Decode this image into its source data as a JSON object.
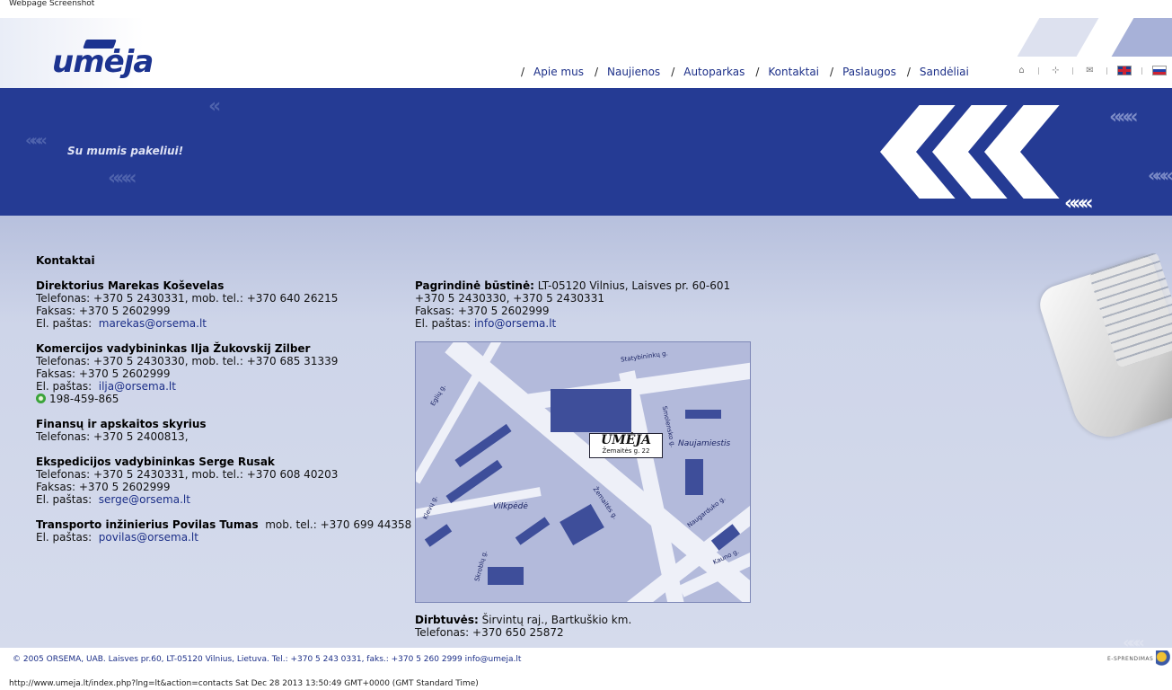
{
  "caption": "Webpage Screenshot",
  "logo": "umėja",
  "nav": [
    "Apie mus",
    "Naujienos",
    "Autoparkas",
    "Kontaktai",
    "Paslaugos",
    "Sandėliai"
  ],
  "tools": [
    "home-icon",
    "sitemap-icon",
    "mail-icon",
    "flag-gb-icon",
    "flag-ru-icon"
  ],
  "banner": {
    "slogan": "Su mumis pakeliui!"
  },
  "contacts": {
    "heading": "Kontaktai",
    "persons": [
      {
        "title": "Direktorius  Marekas Koševelas",
        "phone": "Telefonas:  +370 5 2430331,  mob. tel.:  +370 640 26215",
        "fax": "Faksas: +370 5 2602999",
        "email_label": "El. paštas:",
        "email": "marekas@orsema.lt"
      },
      {
        "title": "Komercijos vadybininkas  Ilja Žukovskij Zilber",
        "phone": "Telefonas:  +370 5 2430330,  mob. tel.:  +370 685 31339",
        "fax": "Faksas: +370 5 2602999",
        "email_label": "El. paštas:",
        "email": "ilja@orsema.lt",
        "icq": "198-459-865"
      },
      {
        "title": "Finansų ir apskaitos skyrius",
        "phone": "Telefonas:  +370 5 2400813,"
      },
      {
        "title": "Ekspedicijos vadybininkas  Serge Rusak",
        "phone": "Telefonas:  +370 5 2430331,  mob. tel.:  +370 608 40203",
        "fax": "Faksas: +370 5 2602999",
        "email_label": "El. paštas:",
        "email": "serge@orsema.lt"
      },
      {
        "title": "Transporto inžinierius  Povilas Tumas",
        "mobile": "mob. tel.:  +370 699 44358",
        "email_label": "El. paštas:",
        "email": "povilas@orsema.lt"
      }
    ]
  },
  "hq": {
    "label": "Pagrindinė būstinė:",
    "address": "LT-05120 Vilnius, Laisves pr. 60-601",
    "phones": "+370 5 2430330, +370 5 2430331",
    "fax": "Faksas: +370 5 2602999",
    "email_label": "El. paštas:",
    "email": "info@orsema.lt"
  },
  "map": {
    "badge_name": "UMĖJA",
    "badge_address": "Žemaitės g. 22",
    "labels": [
      "Statybininkų g.",
      "Eglių g.",
      "Smolensko g.",
      "Naujamiestis",
      "Žemaitės g.",
      "Vilkpėdė",
      "Klevų g.",
      "Naugarduko g.",
      "Skroblų g.",
      "Kauno g."
    ]
  },
  "workshop": {
    "label": "Dirbtuvės:",
    "address": "Širvintų raj., Bartkuškio km.",
    "phone": "Telefonas: +370 650 25872"
  },
  "footer": {
    "copyright": "© 2005 ORSEMA, UAB. Laisves pr.60, LT-05120 Vilnius, Lietuva. Tel.: +370 5 243 0331, faks.: +370 5 260 2999 info@umeja.lt",
    "es_label": "E-SPRENDIMAS"
  },
  "status_url": "http://www.umeja.lt/index.php?lng=lt&action=contacts Sat Dec 28 2013 13:50:49 GMT+0000 (GMT Standard Time)"
}
